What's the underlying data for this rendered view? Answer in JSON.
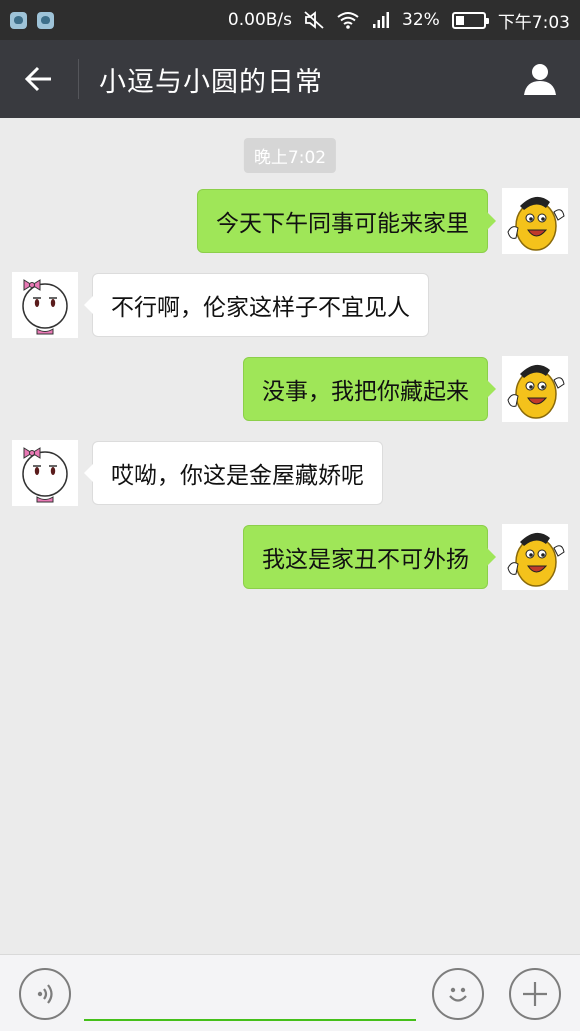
{
  "status_bar": {
    "network_speed": "0.00B/s",
    "battery_percent": "32%",
    "battery_level": 0.32,
    "time": "下午7:03"
  },
  "header": {
    "title": "小逗与小圆的日常"
  },
  "chat": {
    "timestamp": "晚上7:02",
    "messages": [
      {
        "side": "right",
        "text": "今天下午同事可能来家里"
      },
      {
        "side": "left",
        "text": "不行啊，伦家这样子不宜见人"
      },
      {
        "side": "right",
        "text": "没事，我把你藏起来"
      },
      {
        "side": "left",
        "text": "哎呦，你这是金屋藏娇呢"
      },
      {
        "side": "right",
        "text": "我这是家丑不可外扬"
      }
    ]
  },
  "input": {
    "value": "",
    "placeholder": ""
  },
  "colors": {
    "title_bar": "#393a3f",
    "status_bar": "#2e2e2e",
    "sent_bubble": "#9fe658",
    "received_bubble": "#ffffff",
    "chat_background": "#ebebeb",
    "input_underline": "#45c01a"
  },
  "icons": {
    "back": "arrow-left-icon",
    "profile": "person-icon",
    "voice": "voice-icon",
    "emoji": "emoji-icon",
    "more": "plus-icon"
  }
}
